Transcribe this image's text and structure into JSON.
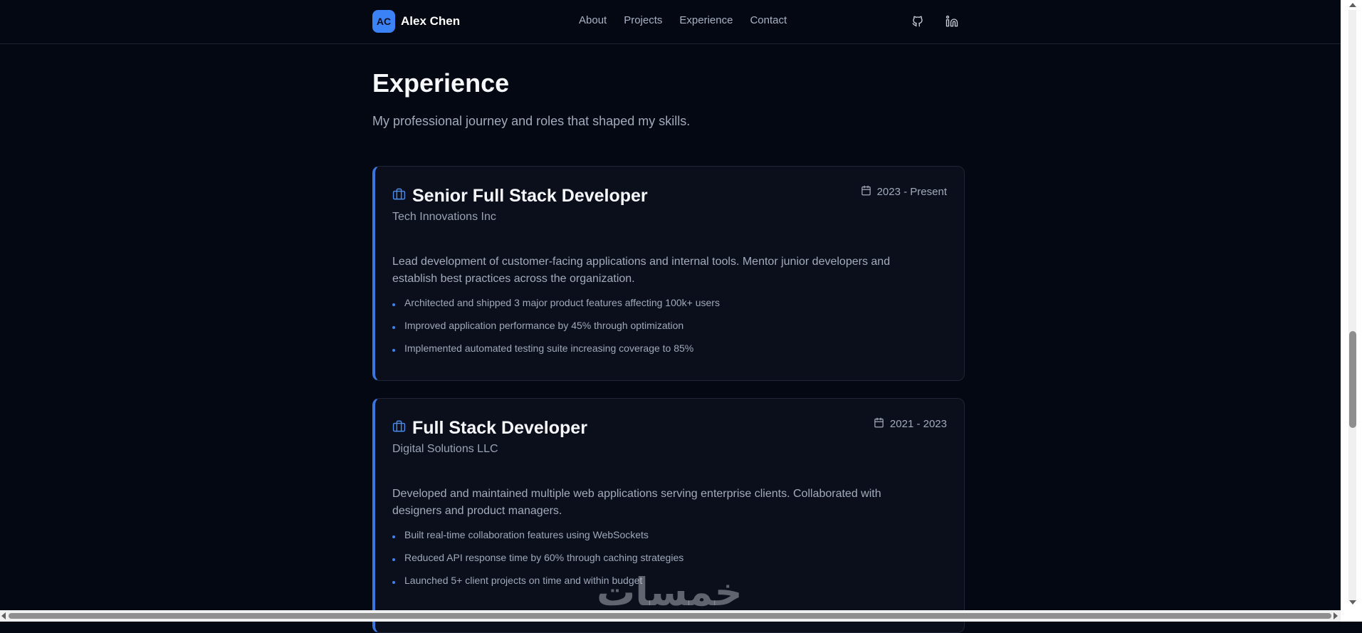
{
  "brand": {
    "initials": "AC",
    "name": "Alex Chen"
  },
  "nav": [
    "About",
    "Projects",
    "Experience",
    "Contact"
  ],
  "social": [
    "github-icon",
    "linkedin-icon"
  ],
  "section": {
    "title": "Experience",
    "subtitle": "My professional journey and roles that shaped my skills."
  },
  "experience": [
    {
      "title": "Senior Full Stack Developer",
      "company": "Tech Innovations Inc",
      "date": "2023 - Present",
      "description": "Lead development of customer-facing applications and internal tools. Mentor junior developers and establish best practices across the organization.",
      "bullets": [
        "Architected and shipped 3 major product features affecting 100k+ users",
        "Improved application performance by 45% through optimization",
        "Implemented automated testing suite increasing coverage to 85%"
      ]
    },
    {
      "title": "Full Stack Developer",
      "company": "Digital Solutions LLC",
      "date": "2021 - 2023",
      "description": "Developed and maintained multiple web applications serving enterprise clients. Collaborated with designers and product managers.",
      "bullets": [
        "Built real-time collaboration features using WebSockets",
        "Reduced API response time by 60% through caching strategies",
        "Launched 5+ client projects on time and within budget"
      ]
    }
  ],
  "watermark": "خمسات",
  "colors": {
    "background": "#040812",
    "accent": "#3b82f6",
    "card": "#0a0f1b"
  }
}
